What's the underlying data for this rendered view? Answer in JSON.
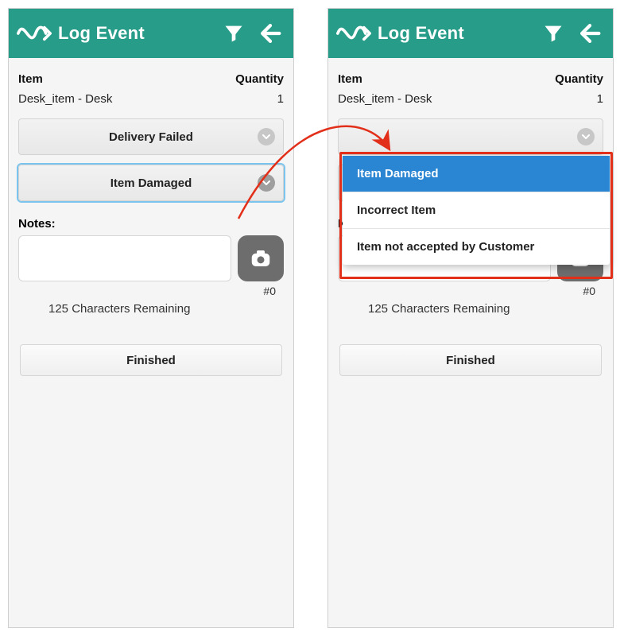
{
  "app": {
    "title": "Log Event"
  },
  "table": {
    "header_item": "Item",
    "header_qty": "Quantity",
    "row_item": "Desk_item - Desk",
    "row_qty": "1"
  },
  "selectors": {
    "delivery_failed": "Delivery Failed",
    "item_damaged": "Item Damaged"
  },
  "dropdown": {
    "options": [
      {
        "label": "Item Damaged",
        "active": true
      },
      {
        "label": "Incorrect Item",
        "active": false
      },
      {
        "label": "Item not accepted by Customer",
        "active": false
      }
    ]
  },
  "notes": {
    "label": "Notes:",
    "hash": "#0",
    "remaining": "125 Characters Remaining"
  },
  "finish": {
    "label": "Finished"
  }
}
